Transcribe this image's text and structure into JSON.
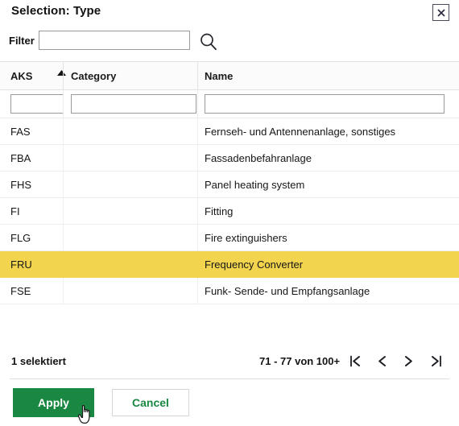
{
  "dialog": {
    "title": "Selection: Type",
    "close_icon": "close-icon"
  },
  "filterbar": {
    "label": "Filter",
    "input_value": "",
    "input_placeholder": "",
    "search_icon": "search-icon",
    "tools": [
      {
        "name": "select-rows-icon",
        "title": "Select rows"
      },
      {
        "name": "row-layout-icon",
        "title": "Row layout"
      },
      {
        "name": "column-settings-icon",
        "title": "Column settings"
      },
      {
        "name": "filter-funnel-icon",
        "title": "Filter"
      }
    ]
  },
  "table": {
    "columns": [
      {
        "key": "aks",
        "label": "AKS",
        "sorted": "asc",
        "filter_value": ""
      },
      {
        "key": "category",
        "label": "Category",
        "sorted": "",
        "filter_value": ""
      },
      {
        "key": "name",
        "label": "Name",
        "sorted": "",
        "filter_value": ""
      }
    ],
    "rows": [
      {
        "aks": "FAS",
        "category": "",
        "name": "Fernseh- und Antennenanlage, sonstiges",
        "selected": false
      },
      {
        "aks": "FBA",
        "category": "",
        "name": "Fassadenbefahranlage",
        "selected": false
      },
      {
        "aks": "FHS",
        "category": "",
        "name": "Panel heating system",
        "selected": false
      },
      {
        "aks": "FI",
        "category": "",
        "name": "Fitting",
        "selected": false
      },
      {
        "aks": "FLG",
        "category": "",
        "name": "Fire extinguishers",
        "selected": false
      },
      {
        "aks": "FRU",
        "category": "",
        "name": "Frequency Converter",
        "selected": true
      },
      {
        "aks": "FSE",
        "category": "",
        "name": "Funk- Sende- und Empfangsanlage",
        "selected": false
      }
    ],
    "selection_highlight_color": "#F2D44E"
  },
  "footer": {
    "selection_count_label": "1 selektiert",
    "page_info": "71 - 77 von 100+",
    "pagination": [
      {
        "name": "first-page-button",
        "glyph": "|<"
      },
      {
        "name": "previous-page-button",
        "glyph": "<"
      },
      {
        "name": "next-page-button",
        "glyph": ">"
      },
      {
        "name": "last-page-button",
        "glyph": ">|"
      }
    ]
  },
  "actions": {
    "apply_label": "Apply",
    "cancel_label": "Cancel",
    "apply_color": "#1A8842"
  }
}
